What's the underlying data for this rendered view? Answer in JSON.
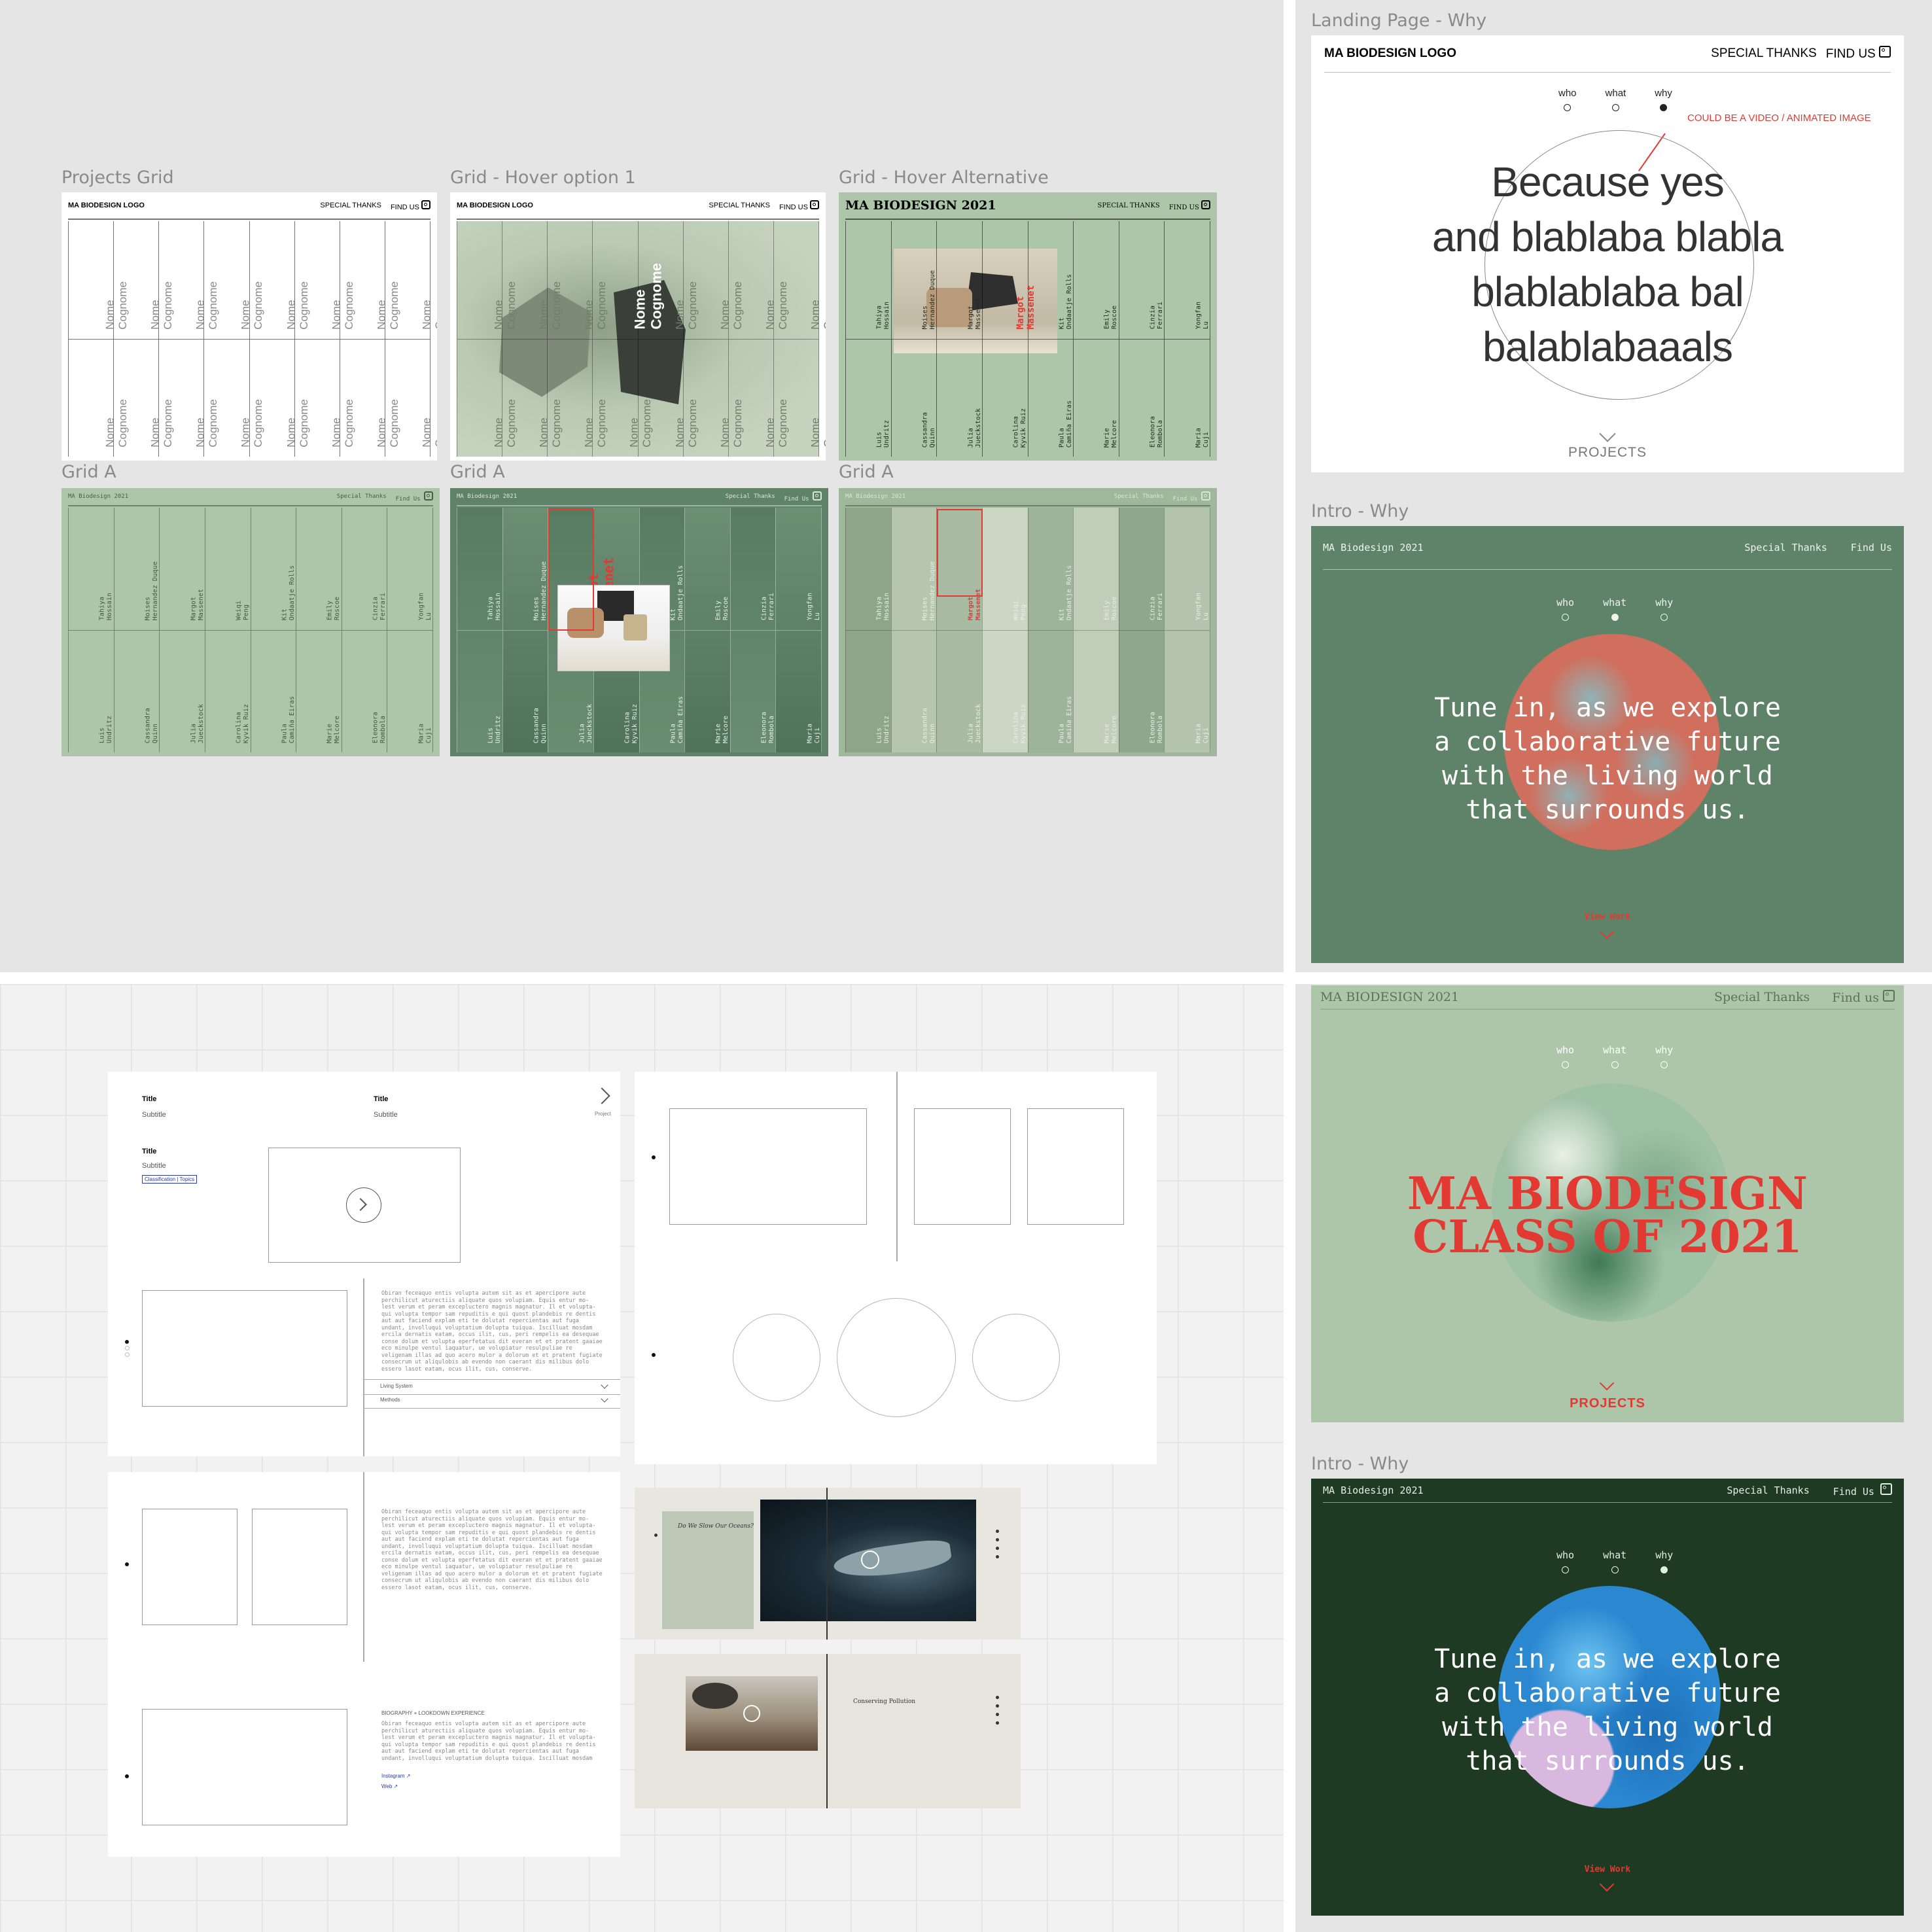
{
  "canvas": {
    "bg": "#e5e5e5",
    "grid_bg": "#f2f2f2"
  },
  "frames": {
    "projects_grid": "Projects Grid",
    "grid_hover_1": "Grid - Hover option 1",
    "grid_hover_alt": "Grid - Hover Alternative",
    "grid_a": "Grid A",
    "landing_why": "Landing Page - Why",
    "intro_why": "Intro - Why"
  },
  "header": {
    "logo": "MA BIODESIGN LOGO",
    "special_thanks": "SPECIAL THANKS",
    "find_us": "FIND US",
    "year_logo": "MA BIODESIGN 2021",
    "year_logo_mono": "MA Biodesign 2021",
    "special_thanks_mono": "Special Thanks",
    "find_us_mono": "Find Us",
    "find_us_serif": "Find us"
  },
  "placeholder_name": "Nome\nCognome",
  "students_top": [
    "Tahiya\nHossain",
    "Moises\nHernandez Duque",
    "Margot\nMassenet",
    "Weiqi\nPeng",
    "Kit\nOndaatje Rolls",
    "Emily\nRoscoe",
    "Cinzia\nFerrari",
    "Yongfan\nLu"
  ],
  "students_bottom": [
    "Luis\nUndritz",
    "Cassandra\nQuinn",
    "Julia\nJueckstock",
    "Carolina\nKyvik Ruiz",
    "Paula\nCamiña Eiras",
    "Marie\nMelcore",
    "Eleonora\nRombola",
    "Maria\nCuji"
  ],
  "highlight_name": "Margot\nMassenet",
  "nav_dots": [
    "who",
    "what",
    "why"
  ],
  "landing": {
    "annotation": "COULD BE A VIDEO / ANIMATED IMAGE",
    "headline": "Because yes\nand blablaba blabla\nblablablaba bal\nbalablabaaals",
    "cta": "PROJECTS"
  },
  "intro": {
    "headline": "Tune in, as we explore\na collaborative future\nwith the living world\nthat surrounds us.",
    "cta": "View Work",
    "class_title": "MA BIODESIGN\nCLASS OF 2021",
    "cta_projects": "PROJECTS"
  },
  "wireframe": {
    "title": "Title",
    "subtitle": "Subtitle",
    "tag": "Classification | Topics",
    "project": "Project",
    "acc_1": "Living System",
    "acc_2": "Methods",
    "bio_heading": "BIOGRAPHY + LOOKDOWN EXPERIENCE",
    "link_1": "Instagram ↗",
    "link_2": "Web ↗",
    "lorem": "Obiran feceaquo entis volupta autem sit as et apercipore aute perchilicut aturectiis aliquate quos volupiam. Equis entur mo- lest verum et peram excepluctero magnis magnatur. Il et volupta- qui volupta tempor sam repuditis e qui quost plandebis re dentis aut aut faciend explam eti te dolutat repercientas aut fuga undant, involluqui voluptatium dolupta tuiqua. Iscilluat mosdam ercila dernatis eatam, occus ilit, cus, peri rempelis ea desequae conse dolum et volupta eperfetatus dit everan et et pratent gaaiae eco minulpe ventul iaquatur, ue volupiatur resulpuliae re veligenam illas ad quo acero mulor a dolorum et et pratent fugiate consecrum ut aliqulobis ab evendo non caerant dis milibus dolo essero lasot eatam, ocus ilit, cus, conserve."
  },
  "mockups": {
    "why_we_slow": "Do We Slow Our Oceans?",
    "pollution": "Conserving Pollution"
  },
  "colors": {
    "sage": "#adc6a9",
    "mid_green": "#5f8369",
    "dark_green": "#1e3a22",
    "coral": "#e14a3e",
    "red": "#e23a33"
  }
}
